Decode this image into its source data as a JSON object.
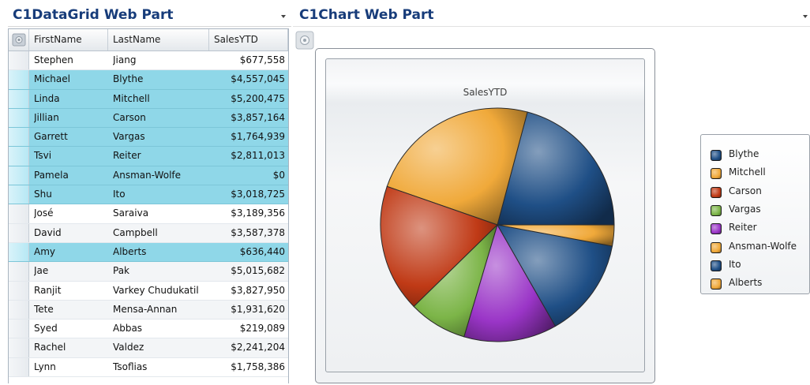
{
  "grid_part": {
    "title": "C1DataGrid Web Part",
    "columns": {
      "first": "FirstName",
      "last": "LastName",
      "sales": "SalesYTD"
    },
    "rows": [
      {
        "first": "Stephen",
        "last": "Jiang",
        "sales": "$677,558",
        "selected": false
      },
      {
        "first": "Michael",
        "last": "Blythe",
        "sales": "$4,557,045",
        "selected": true
      },
      {
        "first": "Linda",
        "last": "Mitchell",
        "sales": "$5,200,475",
        "selected": true
      },
      {
        "first": "Jillian",
        "last": "Carson",
        "sales": "$3,857,164",
        "selected": true
      },
      {
        "first": "Garrett",
        "last": "Vargas",
        "sales": "$1,764,939",
        "selected": true
      },
      {
        "first": "Tsvi",
        "last": "Reiter",
        "sales": "$2,811,013",
        "selected": true
      },
      {
        "first": "Pamela",
        "last": "Ansman-Wolfe",
        "sales": "$0",
        "selected": true
      },
      {
        "first": "Shu",
        "last": "Ito",
        "sales": "$3,018,725",
        "selected": true
      },
      {
        "first": "José",
        "last": "Saraiva",
        "sales": "$3,189,356",
        "selected": false
      },
      {
        "first": "David",
        "last": "Campbell",
        "sales": "$3,587,378",
        "selected": false
      },
      {
        "first": "Amy",
        "last": "Alberts",
        "sales": "$636,440",
        "selected": true
      },
      {
        "first": "Jae",
        "last": "Pak",
        "sales": "$5,015,682",
        "selected": false
      },
      {
        "first": "Ranjit",
        "last": "Varkey Chudukatil",
        "sales": "$3,827,950",
        "selected": false
      },
      {
        "first": "Tete",
        "last": "Mensa-Annan",
        "sales": "$1,931,620",
        "selected": false
      },
      {
        "first": "Syed",
        "last": "Abbas",
        "sales": "$219,089",
        "selected": false
      },
      {
        "first": "Rachel",
        "last": "Valdez",
        "sales": "$2,241,204",
        "selected": false
      },
      {
        "first": "Lynn",
        "last": "Tsoflias",
        "sales": "$1,758,386",
        "selected": false
      }
    ],
    "colors": {
      "selected_row": "#8fd7e8",
      "title": "#173c7a"
    }
  },
  "chart_part": {
    "title": "C1Chart Web Part",
    "chart_data": {
      "type": "pie",
      "title": "SalesYTD",
      "categories": [
        "Blythe",
        "Mitchell",
        "Carson",
        "Vargas",
        "Reiter",
        "Ansman-Wolfe",
        "Ito",
        "Alberts"
      ],
      "values": [
        4557045,
        5200475,
        3857164,
        1764939,
        2811013,
        0,
        3018725,
        636440
      ],
      "colors": [
        "#1f4f86",
        "#f0a93a",
        "#c03a16",
        "#7cb548",
        "#9a35c7",
        "#f0a93a",
        "#1f4f86",
        "#f0a93a"
      ],
      "legend": "right"
    }
  }
}
